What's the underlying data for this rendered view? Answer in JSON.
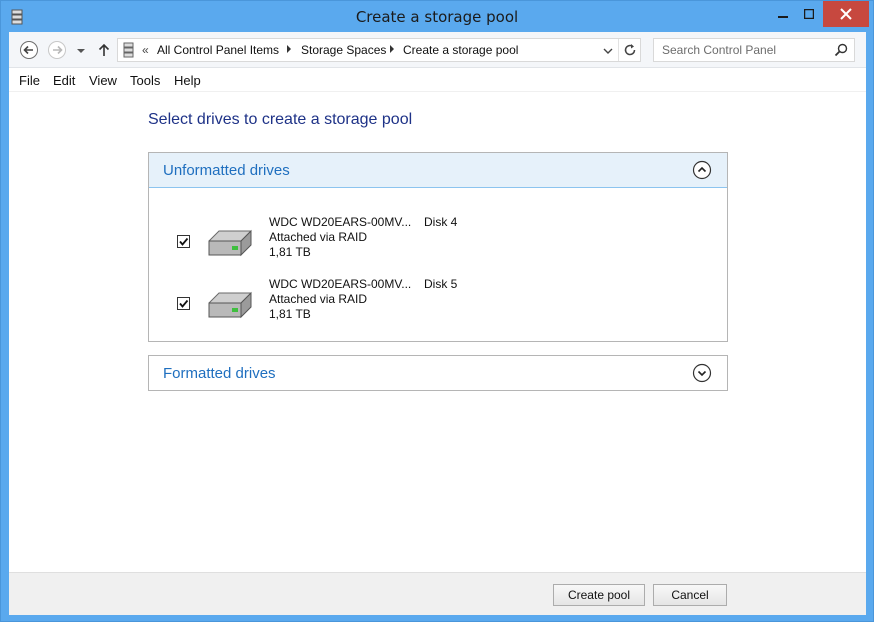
{
  "window": {
    "title": "Create a storage pool",
    "controls": {
      "minimize": "minimize",
      "maximize": "maximize",
      "close": "close"
    }
  },
  "address": {
    "chevron": "«",
    "breadcrumb": [
      "All Control Panel Items",
      "Storage Spaces",
      "Create a storage pool"
    ]
  },
  "search": {
    "placeholder": "Search Control Panel"
  },
  "menu": [
    "File",
    "Edit",
    "View",
    "Tools",
    "Help"
  ],
  "page": {
    "heading": "Select drives to create a storage pool"
  },
  "sections": {
    "unformatted": {
      "title": "Unformatted drives",
      "expanded": true,
      "drives": [
        {
          "name": "WDC WD20EARS-00MV...",
          "connection": "Attached via RAID",
          "size": "1,81 TB",
          "disk": "Disk 4",
          "checked": true
        },
        {
          "name": "WDC WD20EARS-00MV...",
          "connection": "Attached via RAID",
          "size": "1,81 TB",
          "disk": "Disk 5",
          "checked": true
        }
      ]
    },
    "formatted": {
      "title": "Formatted drives",
      "expanded": false
    }
  },
  "footer": {
    "create_label": "Create pool",
    "cancel_label": "Cancel"
  },
  "colors": {
    "frame": "#5aa9ee",
    "heading": "#1e3287",
    "section_title": "#1f6fbf",
    "section_header_bg": "#e6f1fa",
    "close_button": "#c7483f"
  }
}
